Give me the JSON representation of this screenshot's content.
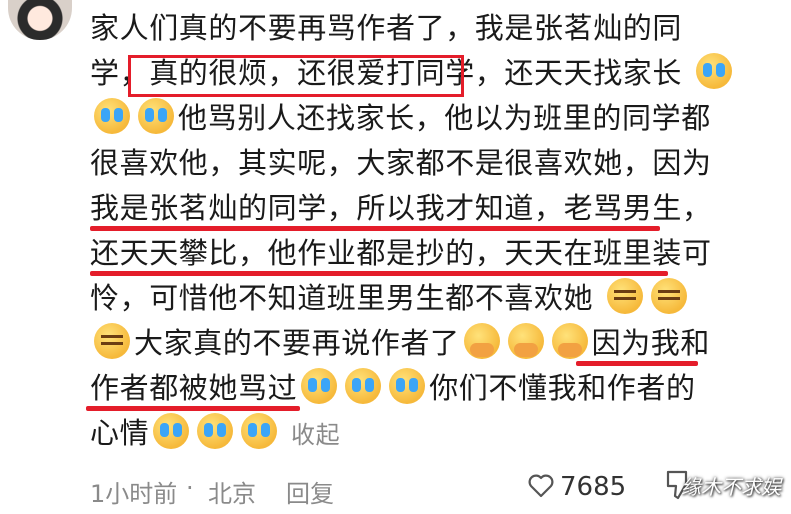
{
  "comment": {
    "lines": [
      "家人们真的不要再骂作者了，我是张茗灿的同",
      "学，真的很烦，还很爱打同学，还天天找家长",
      "他骂别人还找家长，他以为班里的同学都",
      "很喜欢他，其实呢，大家都不是很喜欢她，因为",
      "我是张茗灿的同学，所以我才知道，老骂男生，",
      "还天天攀比，他作业都是抄的，天天在班里装可",
      "怜，可惜他不知道班里男生都不喜欢她",
      "大家真的不要再说作者了",
      "因为我和",
      "作者都被她骂过",
      "你们不懂我和作者的",
      "心情"
    ],
    "collapse_label": "收起"
  },
  "footer": {
    "time": "1小时前",
    "separator": "·",
    "location": "北京",
    "reply_label": "回复",
    "like_count": "7685"
  },
  "watermark": "缘木不求娱",
  "colors": {
    "highlight": "#e41d2a",
    "meta": "#8a8a8a"
  },
  "icons": [
    "cry-emoji-icon",
    "scorn-emoji-icon",
    "cover-mouth-emoji-icon",
    "heart-icon",
    "dislike-icon"
  ]
}
